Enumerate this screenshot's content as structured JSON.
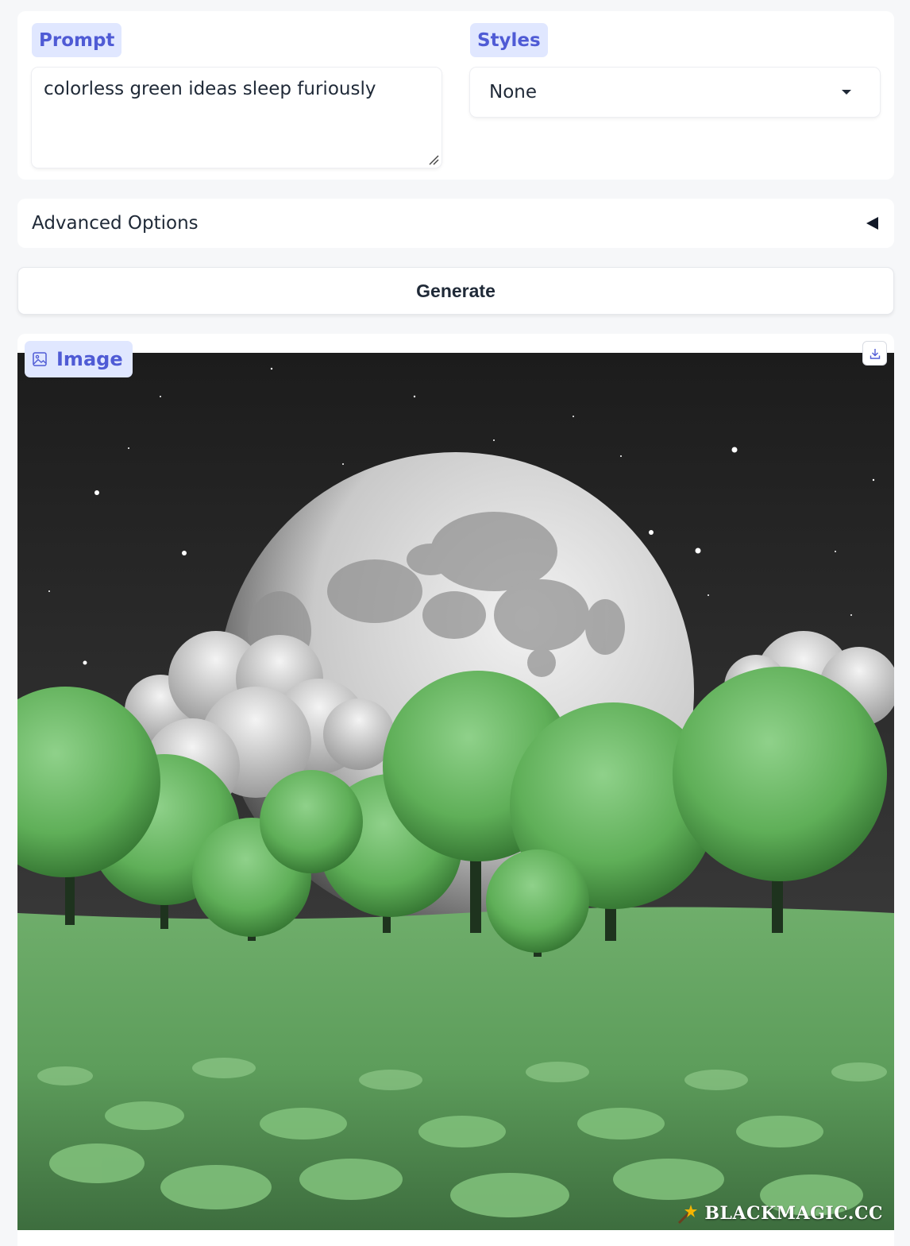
{
  "prompt": {
    "label": "Prompt",
    "value": "colorless green ideas sleep furiously"
  },
  "styles": {
    "label": "Styles",
    "selected": "None"
  },
  "advanced": {
    "label": "Advanced Options"
  },
  "generate": {
    "label": "Generate"
  },
  "output": {
    "label": "Image",
    "watermark": "BLACKMAGIC.CC"
  },
  "icons": {
    "image": "image-icon",
    "download": "download-icon",
    "dropdown": "caret-down-icon",
    "accordion": "triangle-left-icon",
    "resize": "resize-grip-icon"
  },
  "colors": {
    "accent": "#4f5bd5",
    "chip_bg": "#e0e7ff",
    "page_bg": "#f6f7f9"
  }
}
